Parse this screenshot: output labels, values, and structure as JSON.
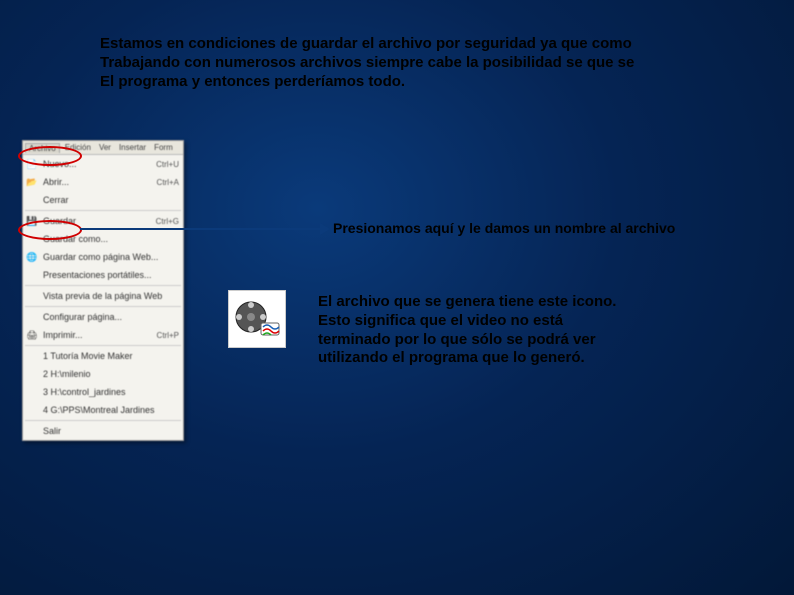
{
  "top": {
    "line1": "Estamos en condiciones de guardar el archivo por seguridad ya que como",
    "line2": "Trabajando con numerosos archivos siempre cabe la posibilidad se que se",
    "line3": "El programa y entonces perderíamos todo."
  },
  "menu": {
    "tabs": [
      "Archivo",
      "Edición",
      "Ver",
      "Insertar",
      "Form"
    ],
    "nuevo": {
      "label": "Nuevo...",
      "shortcut": "Ctrl+U",
      "icon": "📄"
    },
    "abrir": {
      "label": "Abrir...",
      "shortcut": "Ctrl+A",
      "icon": "📂"
    },
    "cerrar": {
      "label": "Cerrar",
      "shortcut": "",
      "icon": ""
    },
    "guardar": {
      "label": "Guardar",
      "shortcut": "Ctrl+G",
      "icon": "💾"
    },
    "guardar_como": {
      "label": "Guardar como...",
      "shortcut": "",
      "icon": ""
    },
    "guardar_web": {
      "label": "Guardar como página Web...",
      "shortcut": "",
      "icon": "🌐"
    },
    "presentaciones": {
      "label": "Presentaciones portátiles...",
      "shortcut": "",
      "icon": ""
    },
    "vista_previa": {
      "label": "Vista previa de la página Web",
      "shortcut": "",
      "icon": ""
    },
    "config_pagina": {
      "label": "Configurar página...",
      "shortcut": "",
      "icon": ""
    },
    "imprimir": {
      "label": "Imprimir...",
      "shortcut": "Ctrl+P",
      "icon": "🖨"
    },
    "recent1": {
      "label": "1 Tutoría Movie Maker",
      "shortcut": "",
      "icon": ""
    },
    "recent2": {
      "label": "2 H:\\milenio",
      "shortcut": "",
      "icon": ""
    },
    "recent3": {
      "label": "3 H:\\control_jardines",
      "shortcut": "",
      "icon": ""
    },
    "recent4": {
      "label": "4 G:\\PPS\\Montreal Jardines",
      "shortcut": "",
      "icon": ""
    },
    "salir": {
      "label": "Salir",
      "shortcut": "",
      "icon": ""
    }
  },
  "mid_text": "Presionamos aquí y le damos un nombre al archivo",
  "bottom": {
    "line1": "El archivo que se genera tiene este icono.",
    "line2": "Esto significa que el video no está",
    "line3": "terminado por lo que sólo se podrá ver",
    "line4": "utilizando el programa que lo generó."
  }
}
